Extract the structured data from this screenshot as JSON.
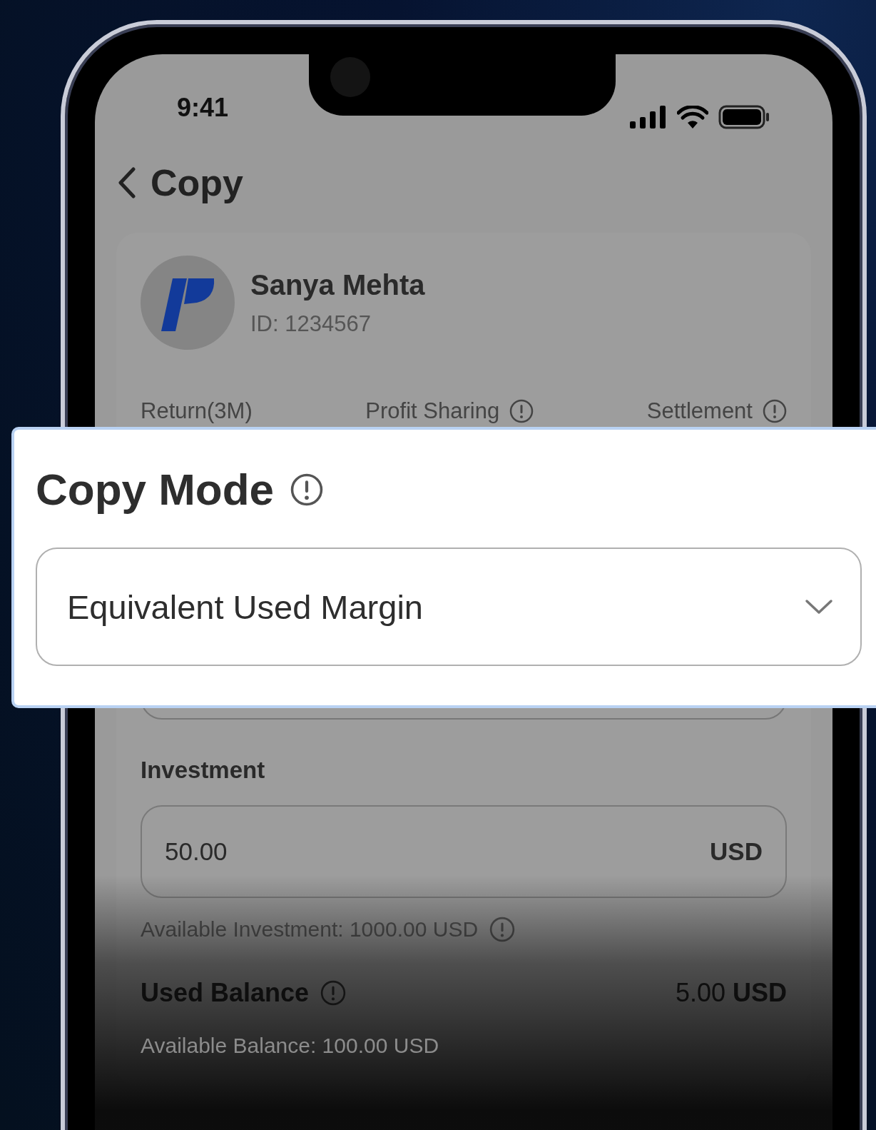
{
  "status_bar": {
    "time": "9:41"
  },
  "header": {
    "title": "Copy"
  },
  "trader": {
    "name": "Sanya Mehta",
    "id": "ID: 1234567",
    "stats": [
      {
        "label": "Return(3M)",
        "info": false
      },
      {
        "label": "Profit Sharing",
        "info": true
      },
      {
        "label": "Settlement",
        "info": true
      }
    ]
  },
  "copy_mode": {
    "title": "Copy Mode",
    "value": "Equivalent Used Margin"
  },
  "investment": {
    "label": "Investment",
    "value": "50.00",
    "unit": "USD",
    "available": "Available Investment: 1000.00 USD"
  },
  "used_balance": {
    "label": "Used Balance",
    "amount": "5.00 **USD**",
    "available": "Available Balance: 100.00 USD"
  }
}
